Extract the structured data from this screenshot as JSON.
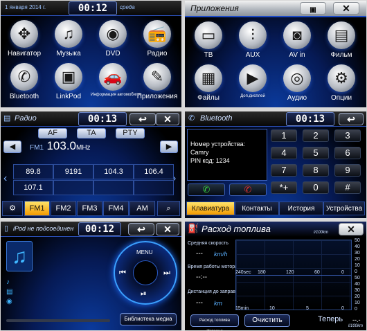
{
  "home": {
    "date": "1 января 2014 г.",
    "time": "00:12",
    "day": "среда",
    "apps": [
      {
        "label": "Навигатор",
        "icon": "compass-icon",
        "glyph": "✥"
      },
      {
        "label": "Музыка",
        "icon": "music-disc-icon",
        "glyph": "♫"
      },
      {
        "label": "DVD",
        "icon": "dvd-disc-icon",
        "glyph": "◉"
      },
      {
        "label": "Радио",
        "icon": "radio-icon",
        "glyph": "📻"
      },
      {
        "label": "Bluetooth",
        "icon": "bluetooth-phone-icon",
        "glyph": "✆"
      },
      {
        "label": "LinkPod",
        "icon": "ipod-icon",
        "glyph": "▣"
      },
      {
        "label": "Информация автомобиля",
        "icon": "car-icon",
        "glyph": "🚗"
      },
      {
        "label": "Приложения",
        "icon": "wrench-icon",
        "glyph": "✎"
      }
    ]
  },
  "applications": {
    "title": "Приложения",
    "apps": [
      {
        "label": "ТВ",
        "icon": "tv-icon",
        "glyph": "▭"
      },
      {
        "label": "AUX",
        "icon": "aux-cable-icon",
        "glyph": "⫶"
      },
      {
        "label": "AV in",
        "icon": "camera-icon",
        "glyph": "◙"
      },
      {
        "label": "Фильм",
        "icon": "film-icon",
        "glyph": "▤"
      },
      {
        "label": "Файлы",
        "icon": "files-icon",
        "glyph": "▦"
      },
      {
        "label": "Доп.дисплей",
        "icon": "display-icon",
        "glyph": "▶"
      },
      {
        "label": "Аудио",
        "icon": "speaker-icon",
        "glyph": "◎"
      },
      {
        "label": "Опции",
        "icon": "gear-icon",
        "glyph": "⚙"
      }
    ]
  },
  "radio": {
    "title": "Радио",
    "time": "00:13",
    "af": "AF",
    "ta": "TA",
    "pty": "PTY",
    "band": "FM1",
    "freq": "103.0",
    "unit": "MHz",
    "presets": [
      "89.8",
      "9191",
      "104.3",
      "106.4",
      "107.1",
      "",
      "",
      ""
    ],
    "bands": [
      "FM1",
      "FM2",
      "FM3",
      "FM4",
      "AM"
    ]
  },
  "bluetooth": {
    "title": "Bluetooth",
    "time": "00:13",
    "device_label": "Номер устройства:",
    "device": "Camry",
    "pin": "PIN код: 1234",
    "keys": [
      "1",
      "2",
      "3",
      "4",
      "5",
      "6",
      "7",
      "8",
      "9",
      "*+",
      "0",
      "#"
    ],
    "tabs": [
      "Клавиатура",
      "Контакты",
      "История",
      "Устройства"
    ]
  },
  "ipod": {
    "status": "iPod не подсоединен",
    "time": "00:12",
    "menu": "MENU",
    "library": "Библиотека медиа"
  },
  "fuel": {
    "title": "Расход топлива",
    "unit_top": "l/100km",
    "avg_speed_label": "Средняя скорость",
    "avg_speed_val": "---",
    "avg_speed_unit": "km/h",
    "engine_time_label": "Время работы мотора",
    "engine_time_val": "--:--",
    "distance_label": "Дистанция до заправки",
    "distance_val": "---",
    "distance_unit": "km",
    "yaxis": [
      "50",
      "40",
      "30",
      "20",
      "10",
      "0"
    ],
    "row1_labels": [
      "240sec",
      "180",
      "120",
      "60",
      "0"
    ],
    "row2_labels": [
      "15min",
      "10",
      "5",
      "0"
    ],
    "history_btn": "Расход топлива История",
    "clear_btn": "Очистить",
    "now_label": "Теперь",
    "now_val": "--.-",
    "unit_bottom": "l/100km"
  }
}
